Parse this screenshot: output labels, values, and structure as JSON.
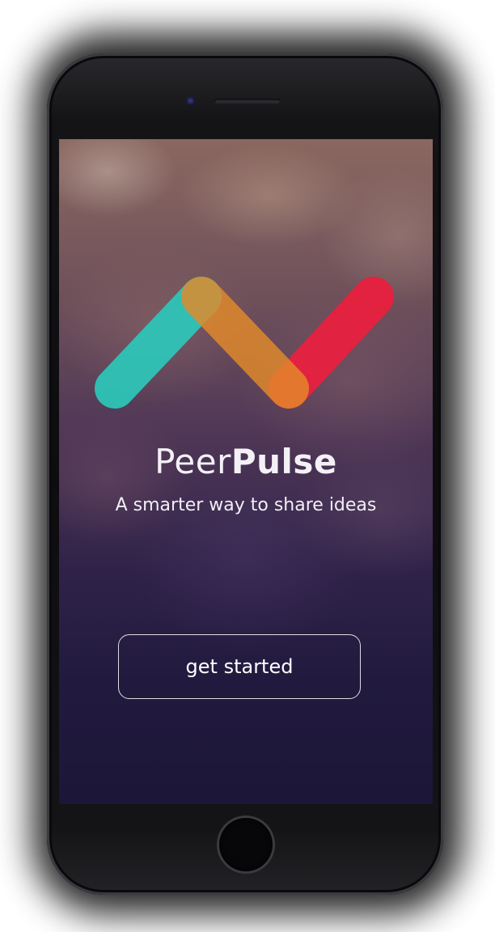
{
  "app": {
    "brand_regular": "Peer",
    "brand_bold": "Pulse",
    "tagline": "A smarter way to share ideas",
    "cta_label": "get started"
  },
  "logo": {
    "icon": "zigzag-pulse-logo",
    "colors": {
      "teal": "#2ec4b6",
      "amber": "#e9a23b",
      "orange": "#f47a2a",
      "red": "#e8203e"
    }
  },
  "device": {
    "type": "smartphone",
    "frame_color": "#141416"
  }
}
